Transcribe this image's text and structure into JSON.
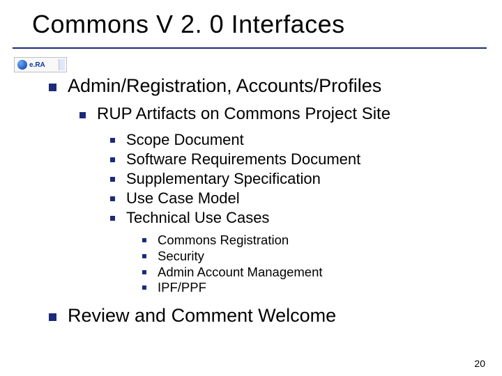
{
  "title": "Commons V 2. 0 Interfaces",
  "logo": {
    "text": "e.RA"
  },
  "bullets": {
    "l1a": "Admin/Registration, Accounts/Profiles",
    "l2a": "RUP Artifacts on Commons Project Site",
    "artifacts": [
      "Scope Document",
      "Software Requirements Document",
      "Supplementary Specification",
      "Use Case Model",
      "Technical Use Cases"
    ],
    "cases": [
      "Commons Registration",
      "Security",
      "Admin Account Management",
      "IPF/PPF"
    ],
    "l1b": "Review and Comment Welcome"
  },
  "page_number": "20"
}
